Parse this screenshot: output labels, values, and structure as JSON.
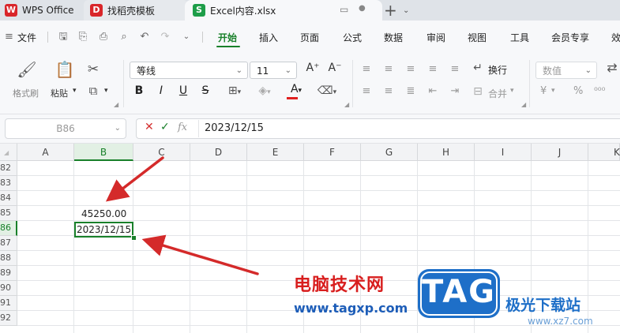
{
  "tabs": {
    "home": "WPS Office",
    "template": "找稻壳模板",
    "file": "Excel内容.xlsx"
  },
  "menu": {
    "file": "文件",
    "items": [
      "开始",
      "插入",
      "页面",
      "公式",
      "数据",
      "审阅",
      "视图",
      "工具",
      "会员专享",
      "效"
    ]
  },
  "ribbon": {
    "format_painter": "格式刷",
    "paste": "粘贴",
    "font_name": "等线",
    "font_size": "11",
    "wrap": "换行",
    "merge": "合并",
    "number_format": "数值",
    "percent_symbol": "%",
    "yen_symbol": "¥"
  },
  "formula_bar": {
    "name_box": "B86",
    "formula": "2023/12/15"
  },
  "grid": {
    "columns": [
      "A",
      "B",
      "C",
      "D",
      "E",
      "F",
      "G",
      "H",
      "I",
      "J",
      "K"
    ],
    "rows": [
      "82",
      "83",
      "84",
      "85",
      "86",
      "87",
      "88",
      "89",
      "90",
      "91",
      "92"
    ],
    "cell_b85": "45250.00",
    "cell_b86": "2023/12/15"
  },
  "watermark": {
    "title": "电脑技术网",
    "url": "www.tagxp.com",
    "logo": "TAG",
    "site_name": "极光下载站",
    "site_url": "www.xz7.com"
  },
  "colors": {
    "accent": "#19802a",
    "arrow": "#d42a2a",
    "tag_logo": "#1e6fc8"
  }
}
